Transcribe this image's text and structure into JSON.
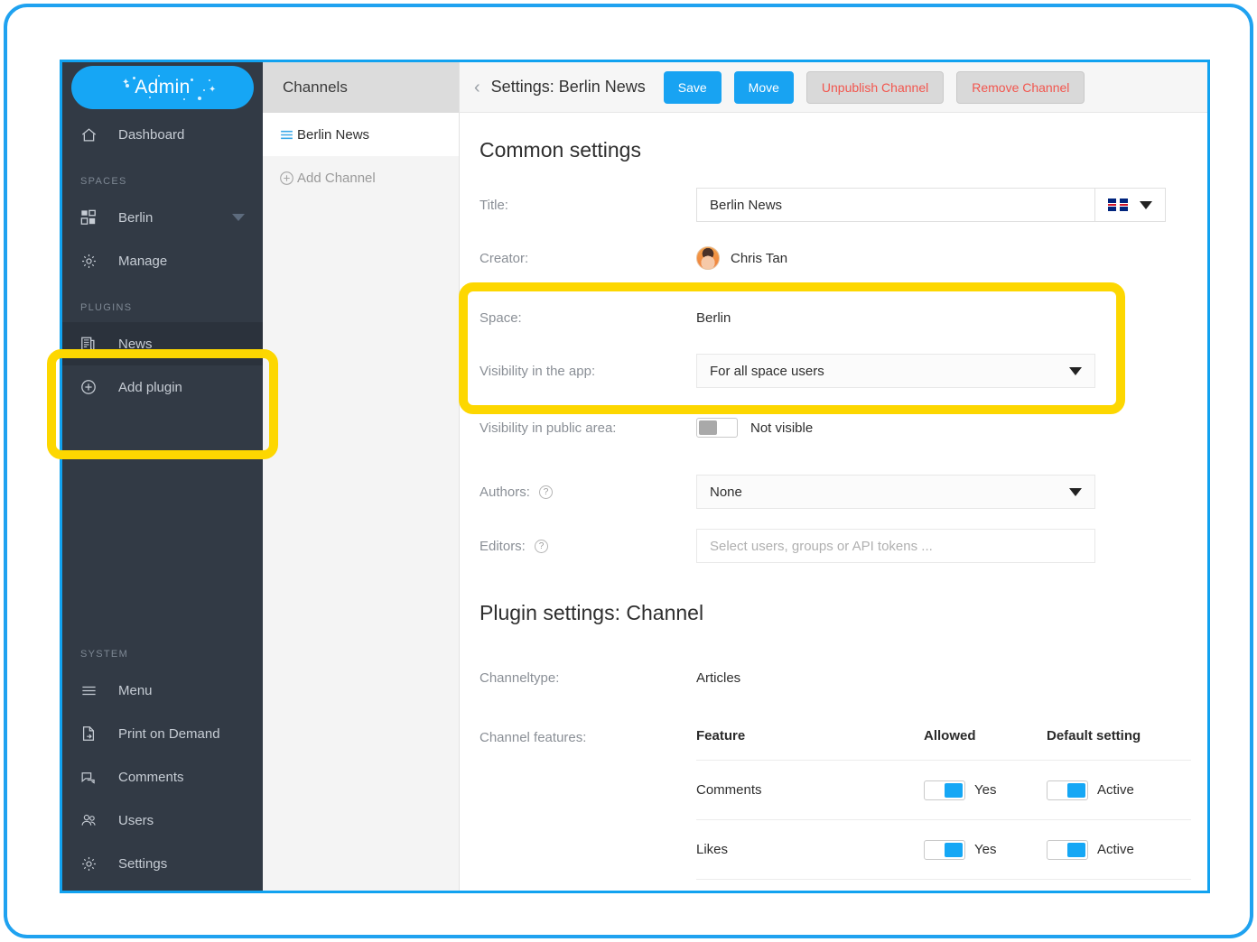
{
  "sidebar": {
    "logo": "Admin",
    "dashboard": {
      "label": "Dashboard",
      "icon": "home-icon"
    },
    "spaces_title": "SPACES",
    "spaces_items": [
      {
        "label": "Berlin",
        "icon": "grid-icon",
        "has_caret": true
      },
      {
        "label": "Manage",
        "icon": "gear-icon",
        "has_caret": false
      }
    ],
    "plugins_title": "PLUGINS",
    "plugins_items": [
      {
        "label": "News",
        "icon": "news-icon",
        "active": true
      },
      {
        "label": "Add plugin",
        "icon": "plus-circle-icon",
        "active": false
      }
    ],
    "system_title": "SYSTEM",
    "system_items": [
      {
        "label": "Menu",
        "icon": "hamburger-icon"
      },
      {
        "label": "Print on Demand",
        "icon": "print-export-icon"
      },
      {
        "label": "Comments",
        "icon": "comments-icon"
      },
      {
        "label": "Users",
        "icon": "users-icon"
      },
      {
        "label": "Settings",
        "icon": "gear-icon"
      }
    ]
  },
  "channels": {
    "header": "Channels",
    "items": [
      {
        "label": "Berlin News",
        "icon": "list-lines-icon",
        "selected": true
      },
      {
        "label": "Add Channel",
        "icon": "plus-circle-icon",
        "selected": false
      }
    ]
  },
  "topbar": {
    "back_icon": "chevron-left-icon",
    "title": "Settings: Berlin News",
    "save_label": "Save",
    "move_label": "Move",
    "unpublish_label": "Unpublish Channel",
    "remove_label": "Remove Channel"
  },
  "common_settings": {
    "heading": "Common settings",
    "title_label": "Title:",
    "title_value": "Berlin News",
    "language_icon": "uk-flag-icon",
    "creator_label": "Creator:",
    "creator_name": "Chris Tan",
    "space_label": "Space:",
    "space_value": "Berlin",
    "visibility_app_label": "Visibility in the app:",
    "visibility_app_value": "For all space users",
    "visibility_public_label": "Visibility in public area:",
    "visibility_public_state": "off",
    "visibility_public_value": "Not visible",
    "authors_label": "Authors:",
    "authors_value": "None",
    "editors_label": "Editors:",
    "editors_placeholder": "Select users, groups or API tokens ..."
  },
  "plugin_settings": {
    "heading": "Plugin settings: Channel",
    "channeltype_label": "Channeltype:",
    "channeltype_value": "Articles",
    "features_label": "Channel features:",
    "columns": [
      "Feature",
      "Allowed",
      "Default setting"
    ],
    "rows": [
      {
        "feature": "Comments",
        "allowed_state": "on",
        "allowed_text": "Yes",
        "default_state": "on",
        "default_text": "Active"
      },
      {
        "feature": "Likes",
        "allowed_state": "on",
        "allowed_text": "Yes",
        "default_state": "on",
        "default_text": "Active"
      }
    ]
  },
  "colors": {
    "accent_blue": "#16a6f5",
    "sidebar_dark": "#323a45",
    "annotation_yellow": "#fdd700",
    "danger_red": "#f2564e"
  }
}
